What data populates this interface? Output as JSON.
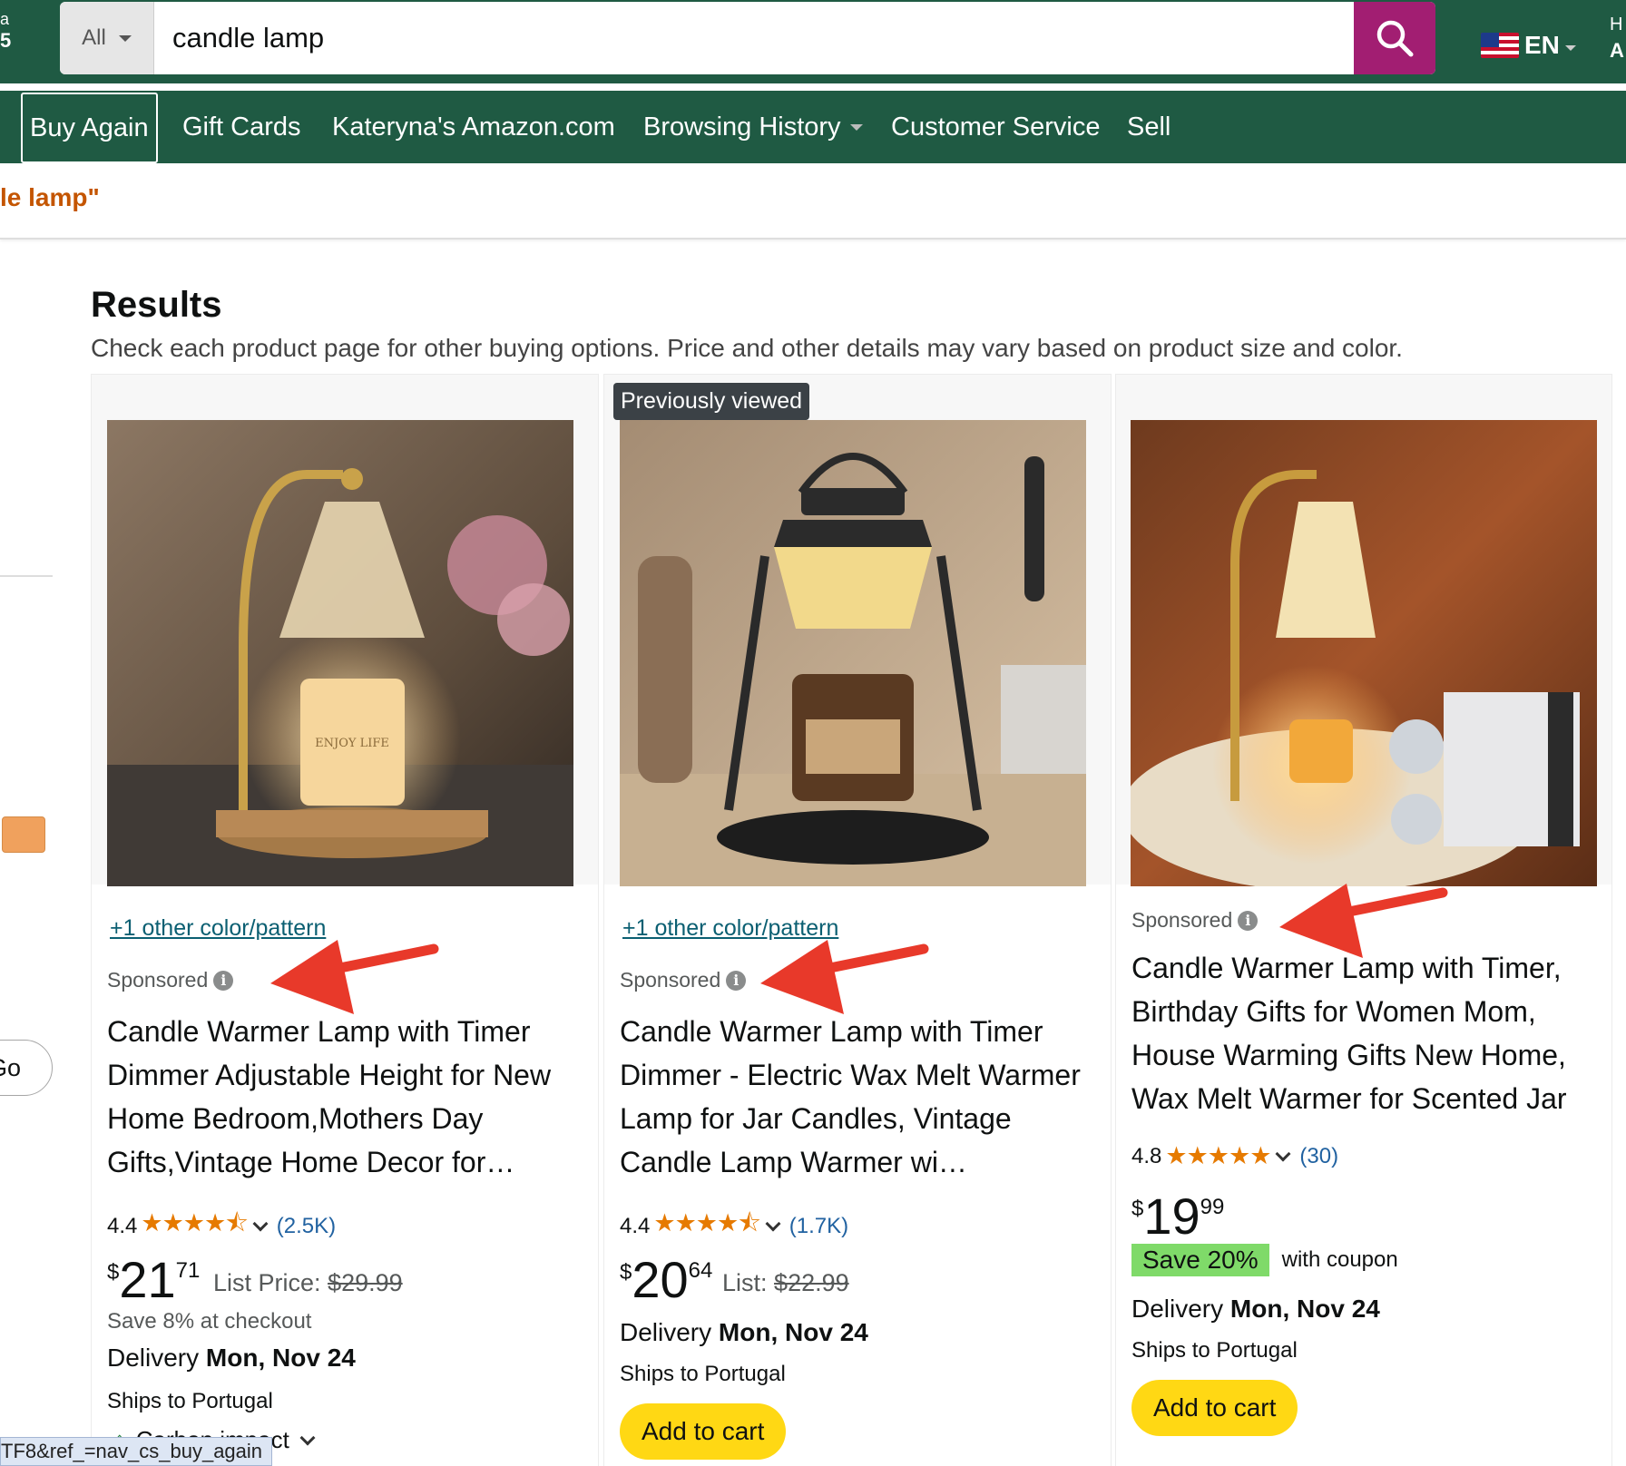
{
  "header": {
    "edge_left_line1": "a",
    "edge_left_line2": "5",
    "search_category": "All",
    "search_value": "candle lamp",
    "search_icon": "search-icon",
    "language": "EN",
    "edge_right_line1": "H",
    "edge_right_line2": "A"
  },
  "nav": {
    "items": [
      {
        "label": "Buy Again"
      },
      {
        "label": "Gift Cards"
      },
      {
        "label": "Kateryna's Amazon.com"
      },
      {
        "label": "Browsing History"
      },
      {
        "label": "Customer Service"
      },
      {
        "label": "Sell"
      }
    ]
  },
  "breadcrumb": {
    "text": "le lamp\""
  },
  "sidebar": {
    "go_label": "Go",
    "swatch_color": "#f0a15d"
  },
  "results": {
    "title": "Results",
    "subtitle": "Check each product page for other buying options. Price and other details may vary based on product size and color."
  },
  "products": [
    {
      "variant_link": "+1 other color/pattern",
      "sponsored": "Sponsored",
      "title": "Candle Warmer Lamp with Timer Dimmer Adjustable Height for New Home Bedroom,Mothers Day Gifts,Vintage Home Decor for…",
      "rating": "4.4",
      "stars": "★★★★⯪",
      "rating_count": "(2.5K)",
      "price_symbol": "$",
      "price_whole": "21",
      "price_fraction": "71",
      "list_label": "List Price:",
      "list_price": "$29.99",
      "save_note": "Save 8% at checkout",
      "delivery_label": "Delivery",
      "delivery_date": "Mon, Nov 24",
      "ships": "Ships to Portugal",
      "carbon": "Carbon impact"
    },
    {
      "badge": "Previously viewed",
      "variant_link": "+1 other color/pattern",
      "sponsored": "Sponsored",
      "title": "Candle Warmer Lamp with Timer Dimmer - Electric Wax Melt Warmer Lamp for Jar Candles, Vintage Candle Lamp Warmer wi…",
      "rating": "4.4",
      "stars": "★★★★⯪",
      "rating_count": "(1.7K)",
      "price_symbol": "$",
      "price_whole": "20",
      "price_fraction": "64",
      "list_label": "List:",
      "list_price": "$22.99",
      "delivery_label": "Delivery",
      "delivery_date": "Mon, Nov 24",
      "ships": "Ships to Portugal",
      "add_to_cart": "Add to cart"
    },
    {
      "sponsored": "Sponsored",
      "title": "Candle Warmer Lamp with Timer, Birthday Gifts for Women Mom, House Warming Gifts New Home, Wax Melt Warmer for Scented Jar",
      "rating": "4.8",
      "stars": "★★★★★",
      "rating_count": "(30)",
      "price_symbol": "$",
      "price_whole": "19",
      "price_fraction": "99",
      "coupon_badge": "Save 20%",
      "coupon_text": "with coupon",
      "delivery_label": "Delivery",
      "delivery_date": "Mon, Nov 24",
      "ships": "Ships to Portugal",
      "add_to_cart": "Add to cart"
    }
  ],
  "status_bar": {
    "url": "TF8&ref_=nav_cs_buy_again"
  },
  "colors": {
    "header_bg": "#1f5a43",
    "search_button": "#a21e72",
    "add_to_cart": "#ffd814",
    "stars": "#e67a00",
    "link": "#0b5f72",
    "coupon": "#7fda69",
    "annotation_arrow": "#e8392a"
  }
}
